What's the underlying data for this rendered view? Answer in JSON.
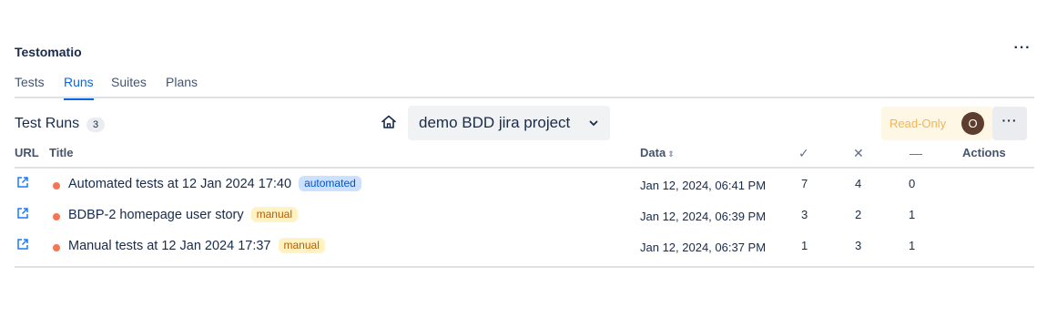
{
  "app": {
    "title": "Testomatio",
    "more_label": "···"
  },
  "tabs": [
    {
      "label": "Tests",
      "active": false
    },
    {
      "label": "Runs",
      "active": true
    },
    {
      "label": "Suites",
      "active": false
    },
    {
      "label": "Plans",
      "active": false
    }
  ],
  "section": {
    "title": "Test Runs",
    "count": "3"
  },
  "project": {
    "name": "demo BDD jira project"
  },
  "access": {
    "label": "Read-Only",
    "avatar_initial": "O"
  },
  "more_button": "···",
  "table": {
    "headers": {
      "url": "URL",
      "title": "Title",
      "data": "Data",
      "passed": "✓",
      "failed": "✕",
      "skipped": "—",
      "actions": "Actions"
    },
    "rows": [
      {
        "title": "Automated tests at 12 Jan 2024 17:40",
        "tag": "automated",
        "date": "Jan 12, 2024, 06:41 PM",
        "passed": "7",
        "failed": "4",
        "skipped": "0"
      },
      {
        "title": "BDBP-2 homepage user story",
        "tag": "manual",
        "date": "Jan 12, 2024, 06:39 PM",
        "passed": "3",
        "failed": "2",
        "skipped": "1"
      },
      {
        "title": "Manual tests at 12 Jan 2024 17:37",
        "tag": "manual",
        "date": "Jan 12, 2024, 06:37 PM",
        "passed": "1",
        "failed": "3",
        "skipped": "1"
      }
    ]
  },
  "colors": {
    "accent": "#0c66e4",
    "status_dot": "#f87455",
    "readonly_text": "#f5b450",
    "avatar_bg": "#5c3d2e"
  },
  "icons": {
    "home": "home-icon",
    "external_link": "external-link-icon",
    "chevron": "chevron-down-icon"
  }
}
